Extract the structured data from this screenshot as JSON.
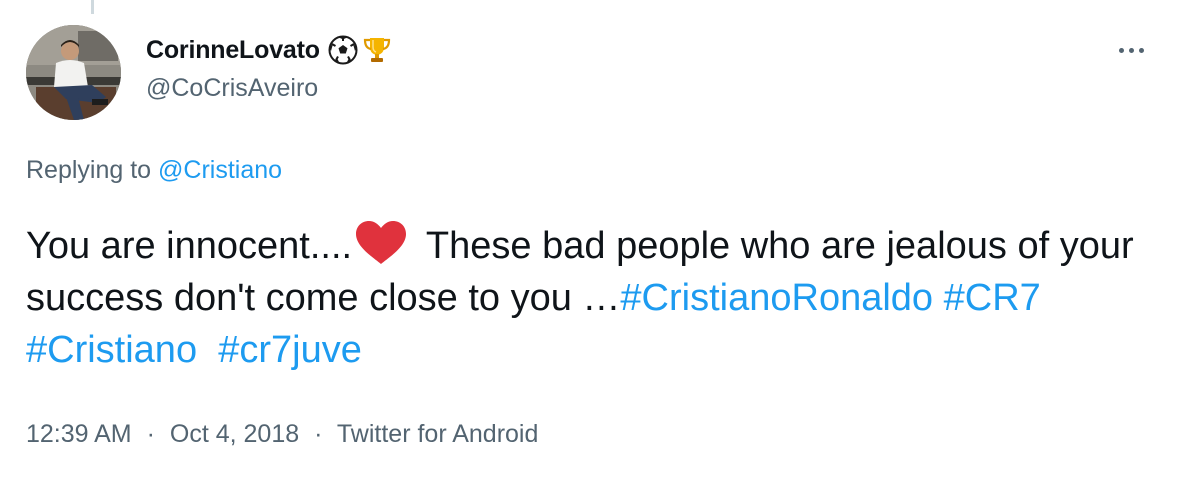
{
  "tweet": {
    "author": {
      "display_name": "CorinneLovato",
      "badge_emojis": [
        "soccer-ball-icon",
        "trophy-icon"
      ],
      "handle": "@CoCrisAveiro"
    },
    "reply": {
      "prefix": "Replying to",
      "mention": "@Cristiano"
    },
    "text": {
      "part1": "You are innocent....",
      "emoji": "red-heart-icon",
      "part2": " These bad people who are jealous of your success don't come close to you …",
      "hashtags": [
        "#CristianoRonaldo",
        "#CR7",
        "#Cristiano",
        "#cr7juve"
      ]
    },
    "meta": {
      "time": "12:39 AM",
      "separator": "·",
      "date": "Oct 4, 2018",
      "source": "Twitter for Android"
    }
  },
  "colors": {
    "text_primary": "#0f1419",
    "text_secondary": "#536471",
    "link": "#1d9bf0",
    "heart": "#e0323d"
  }
}
